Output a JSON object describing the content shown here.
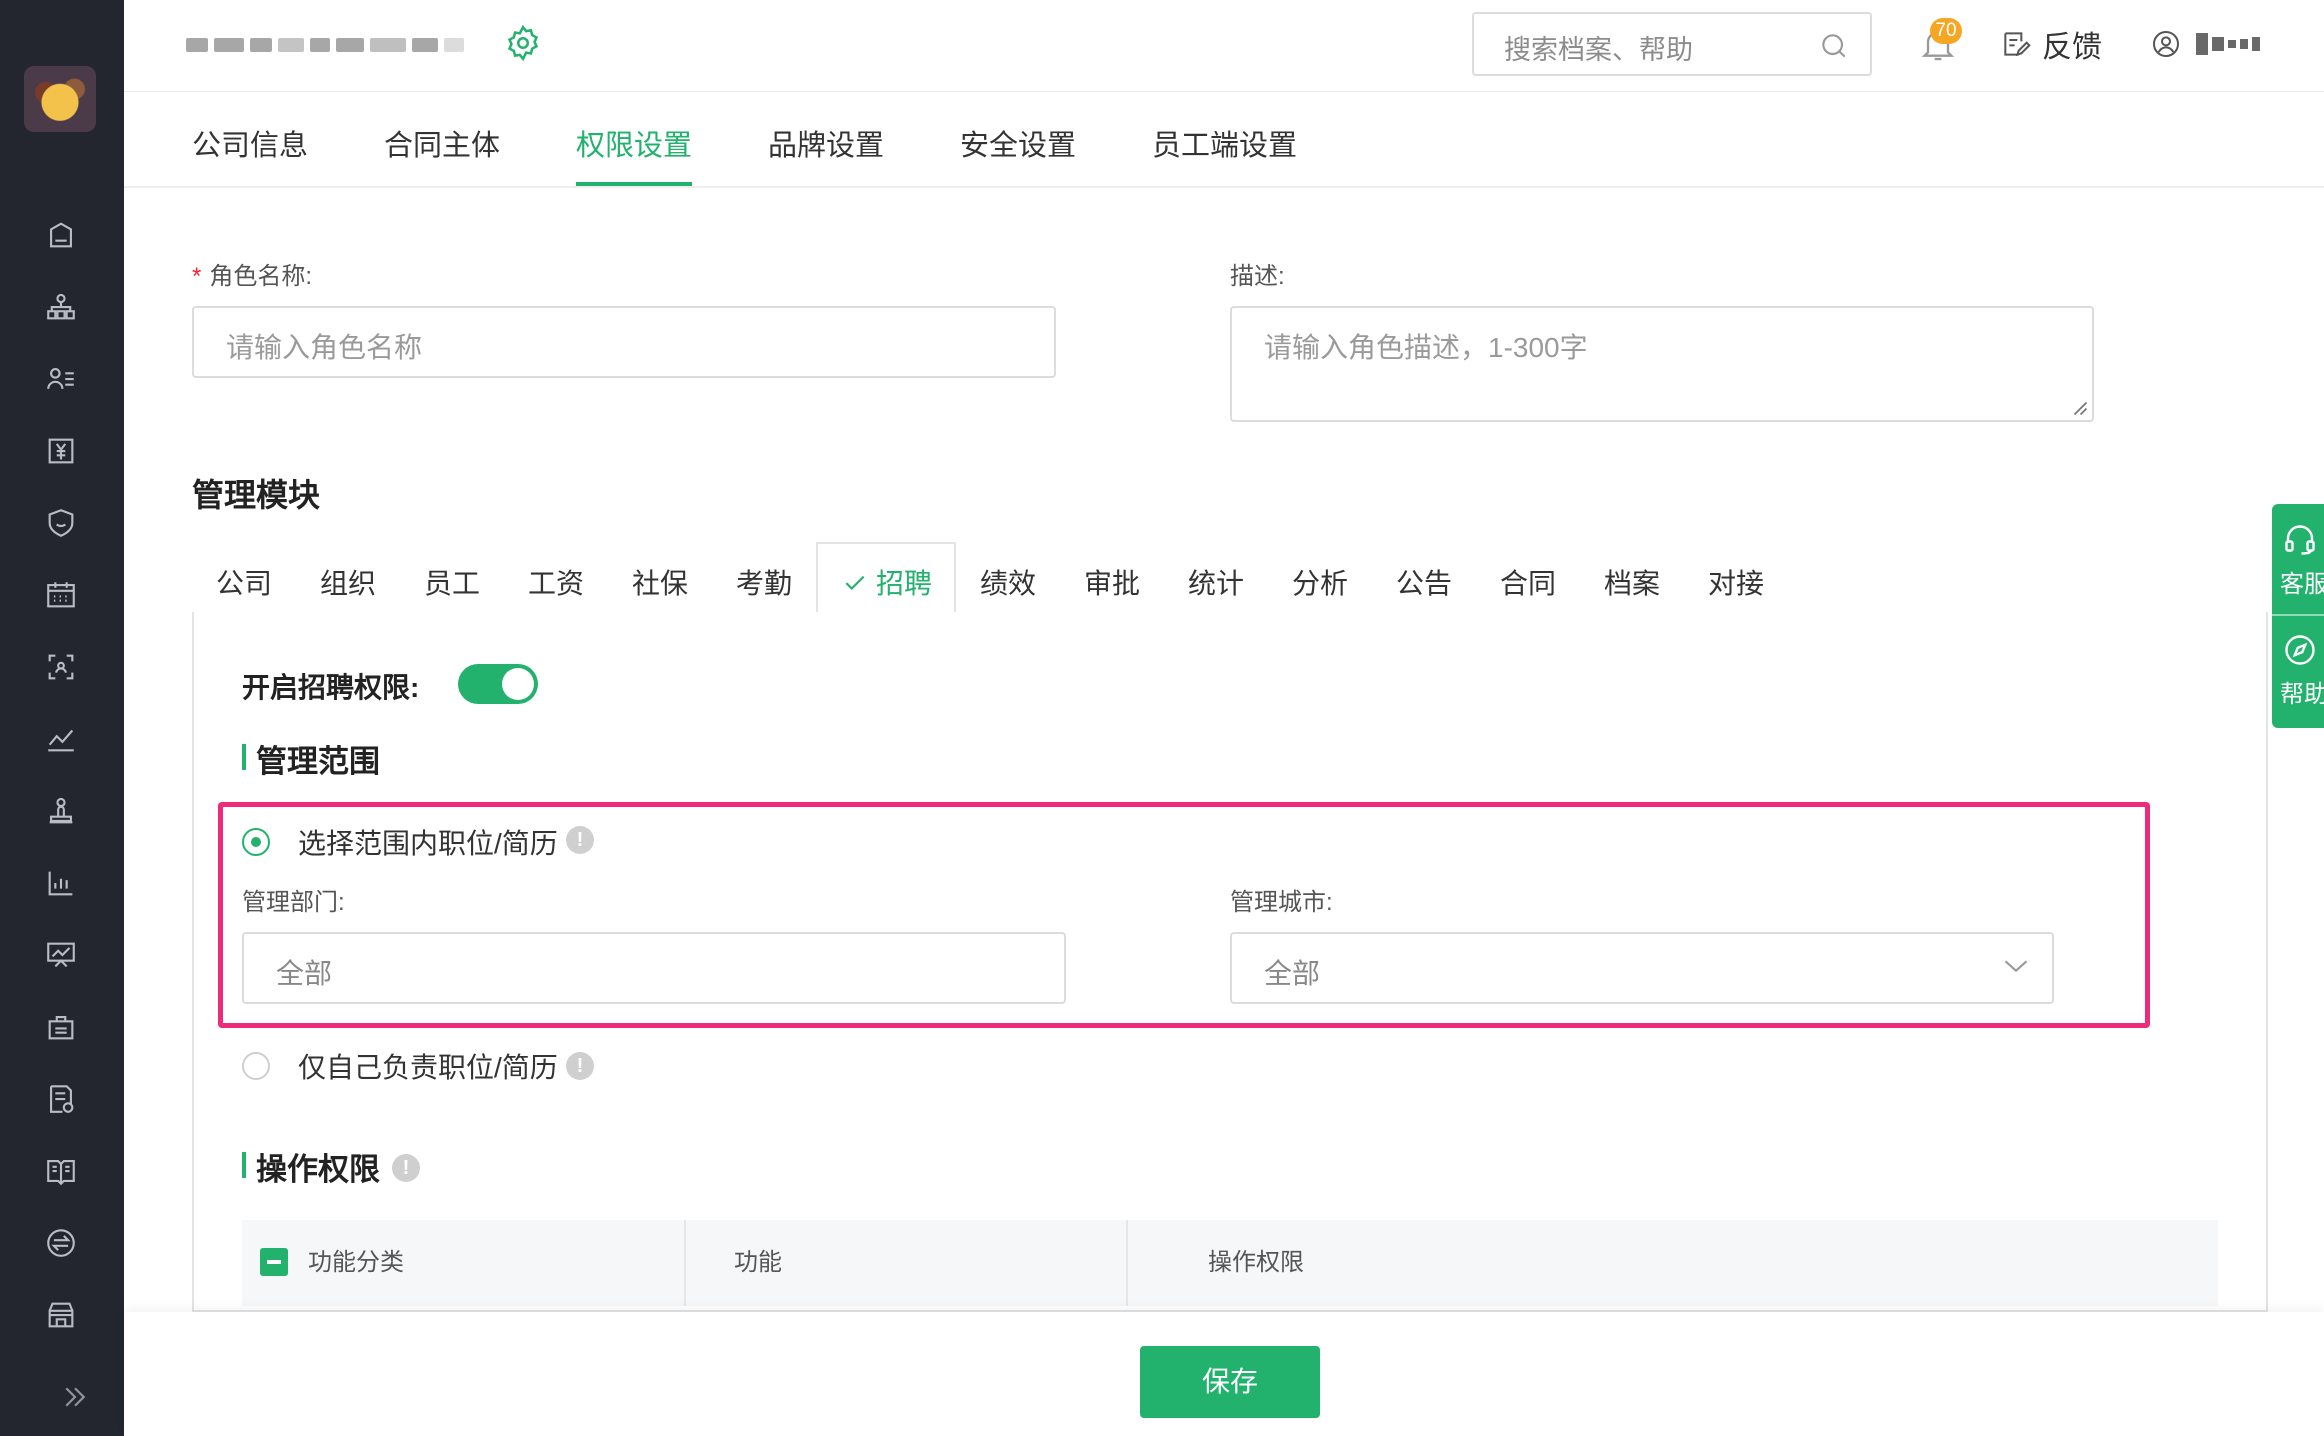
{
  "brand": {
    "accent": "#23b26d",
    "highlight": "#ee2a7b",
    "sidebar_bg": "#23262e"
  },
  "header": {
    "search_placeholder": "搜索档案、帮助",
    "notification_count": "70",
    "feedback_label": "反馈"
  },
  "top_tabs": [
    {
      "label": "公司信息"
    },
    {
      "label": "合同主体"
    },
    {
      "label": "权限设置",
      "active": true
    },
    {
      "label": "品牌设置"
    },
    {
      "label": "安全设置"
    },
    {
      "label": "员工端设置"
    }
  ],
  "form": {
    "role_name_label": "角色名称:",
    "role_name_required": "*",
    "role_name_placeholder": "请输入角色名称",
    "desc_label": "描述:",
    "desc_placeholder": "请输入角色描述，1-300字"
  },
  "modules": {
    "title": "管理模块",
    "tabs": [
      {
        "label": "公司"
      },
      {
        "label": "组织"
      },
      {
        "label": "员工"
      },
      {
        "label": "工资"
      },
      {
        "label": "社保"
      },
      {
        "label": "考勤"
      },
      {
        "label": "招聘",
        "active": true
      },
      {
        "label": "绩效"
      },
      {
        "label": "审批"
      },
      {
        "label": "统计"
      },
      {
        "label": "分析"
      },
      {
        "label": "公告"
      },
      {
        "label": "合同"
      },
      {
        "label": "档案"
      },
      {
        "label": "对接"
      }
    ]
  },
  "recruit": {
    "enable_label": "开启招聘权限:",
    "enabled": true,
    "scope_title": "管理范围",
    "option_scope": "选择范围内职位/简历",
    "dept_label": "管理部门:",
    "dept_value": "全部",
    "city_label": "管理城市:",
    "city_value": "全部",
    "option_own": "仅自己负责职位/简历",
    "ops_title": "操作权限",
    "info_glyph": "!"
  },
  "table": {
    "columns": [
      "功能分类",
      "功能",
      "操作权限"
    ]
  },
  "footer": {
    "save_label": "保存"
  },
  "float_panel": {
    "service_label": "客服",
    "help_label": "帮助"
  },
  "sidebar_icons": [
    "home-icon",
    "org-chart-icon",
    "employee-list-icon",
    "salary-icon",
    "social-security-icon",
    "calendar-icon",
    "recruit-scan-icon",
    "performance-chart-icon",
    "approval-stamp-icon",
    "statistics-icon",
    "analysis-board-icon",
    "notice-icon",
    "contract-icon",
    "archive-book-icon",
    "integration-icon",
    "store-icon"
  ]
}
